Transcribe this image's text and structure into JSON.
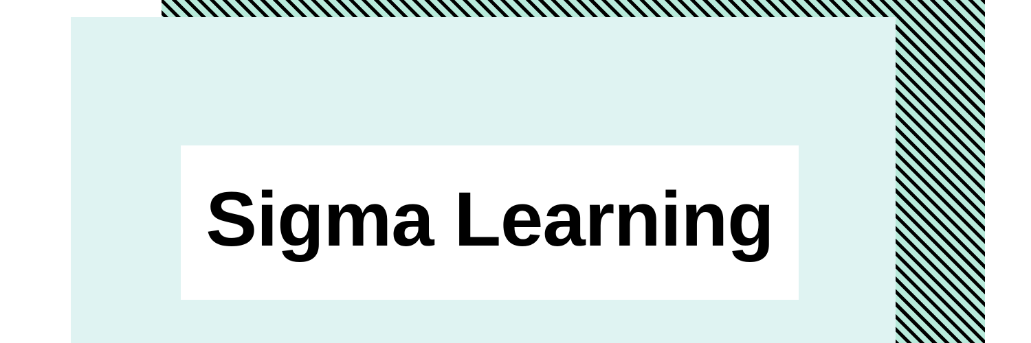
{
  "banner": {
    "title": "Sigma Learning"
  },
  "colors": {
    "panel": "#dff3f2",
    "stripe_light": "#b8eadb",
    "stripe_dark": "#000000",
    "title_box": "#ffffff",
    "title_text": "#000000"
  }
}
